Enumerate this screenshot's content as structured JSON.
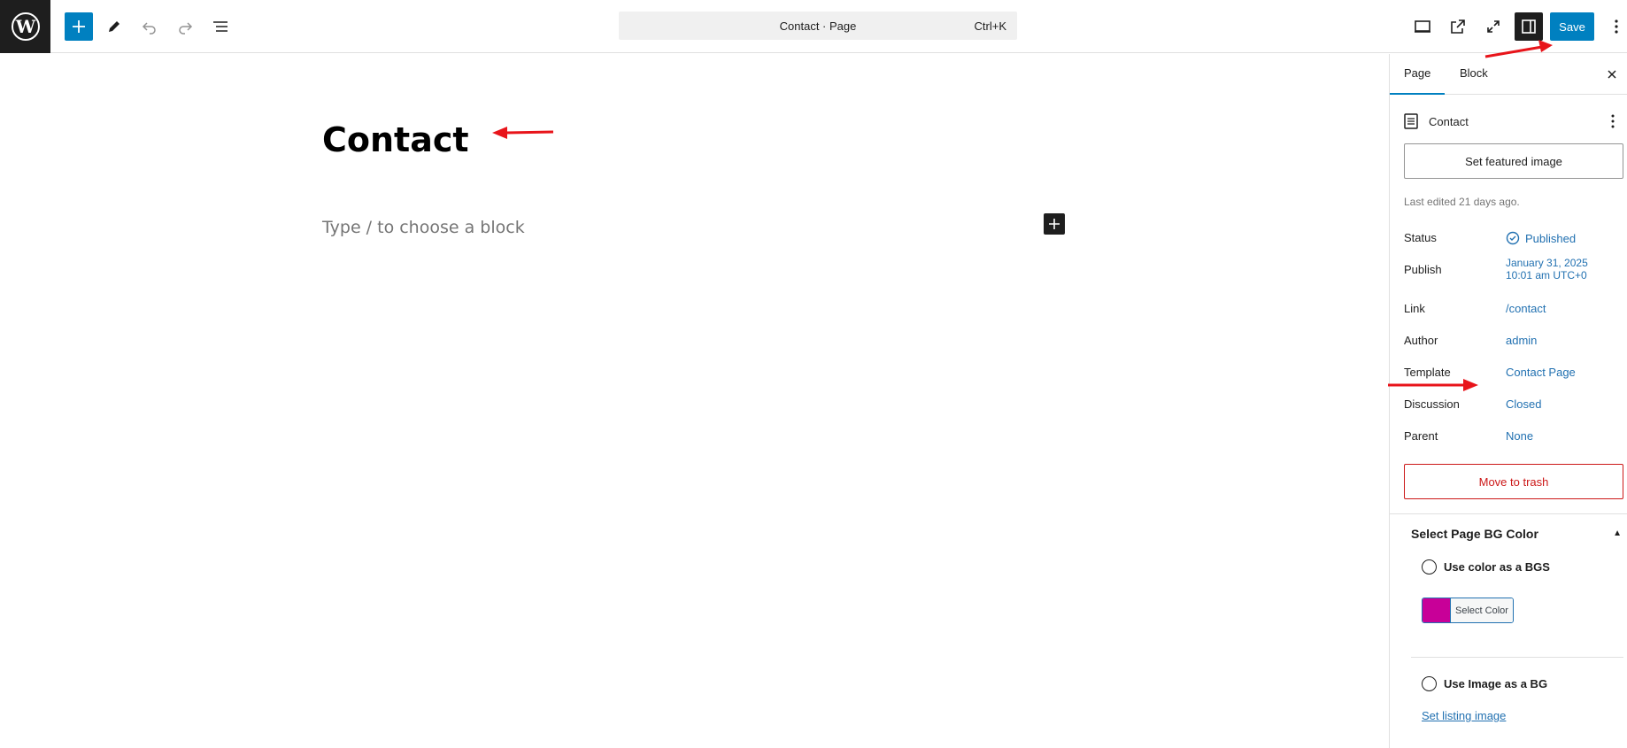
{
  "topbar": {
    "command_title": "Contact · Page",
    "command_shortcut": "Ctrl+K",
    "save_label": "Save"
  },
  "editor": {
    "page_title": "Contact",
    "block_placeholder": "Type / to choose a block"
  },
  "sidebar": {
    "tabs": [
      {
        "label": "Page",
        "active": true
      },
      {
        "label": "Block",
        "active": false
      }
    ],
    "document_label": "Contact",
    "featured_image_label": "Set featured image",
    "last_edited": "Last edited 21 days ago.",
    "meta": {
      "status_key": "Status",
      "status_value": "Published",
      "publish_key": "Publish",
      "publish_value_line1": "January 31, 2025",
      "publish_value_line2": "10:01 am UTC+0",
      "link_key": "Link",
      "link_value": "/contact",
      "author_key": "Author",
      "author_value": "admin",
      "template_key": "Template",
      "template_value": "Contact Page",
      "discussion_key": "Discussion",
      "discussion_value": "Closed",
      "parent_key": "Parent",
      "parent_value": "None"
    },
    "trash_label": "Move to trash",
    "bg_panel": {
      "title": "Select Page BG Color",
      "use_color_label": "Use color as a BGS",
      "select_color_label": "Select Color",
      "swatch_color": "#c80098",
      "use_image_label": "Use Image as a BG",
      "set_listing_image_label": "Set listing image"
    }
  },
  "colors": {
    "accent": "#0080c0",
    "link": "#2271b1",
    "danger": "#cc1818",
    "annotation": "#e8141a"
  }
}
